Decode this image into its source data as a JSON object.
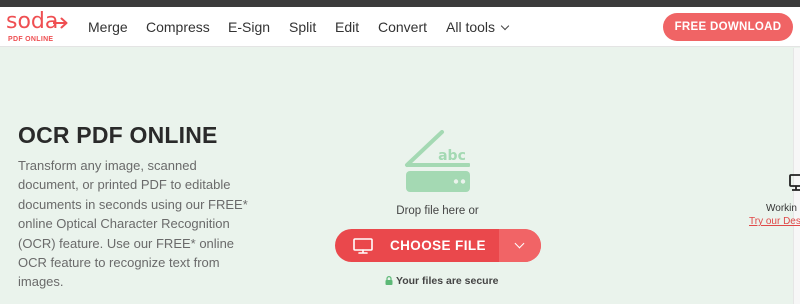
{
  "header": {
    "logo_word": "soda",
    "logo_sub": "PDF ONLINE",
    "nav": [
      {
        "label": "Merge"
      },
      {
        "label": "Compress"
      },
      {
        "label": "E-Sign"
      },
      {
        "label": "Split"
      },
      {
        "label": "Edit"
      },
      {
        "label": "Convert"
      },
      {
        "label": "All tools"
      }
    ],
    "download_label": "FREE DOWNLOAD"
  },
  "hero": {
    "title": "OCR PDF ONLINE",
    "description": "Transform any image, scanned document, or printed PDF to editable documents in seconds using our FREE* online Optical Character Recognition (OCR) feature. Use our FREE* online OCR feature to recognize text from images.",
    "scanner_text": "abc",
    "drop_text": "Drop file here or",
    "choose_label": "CHOOSE FILE",
    "secure_text": "Your files are secure"
  },
  "side": {
    "working_text": "Workin",
    "try_link": "Try our Des"
  },
  "icons": {
    "scanner": "scanner-icon",
    "monitor": "monitor-icon",
    "dropdown": "chevron-down-icon",
    "lock": "lock-icon",
    "desktop": "desktop-icon"
  },
  "colors": {
    "brand": "#ef4f52",
    "button": "#ea484c",
    "button_light": "#f06465",
    "background": "#eaf3ec",
    "scanner_green": "#a4d9b3"
  }
}
